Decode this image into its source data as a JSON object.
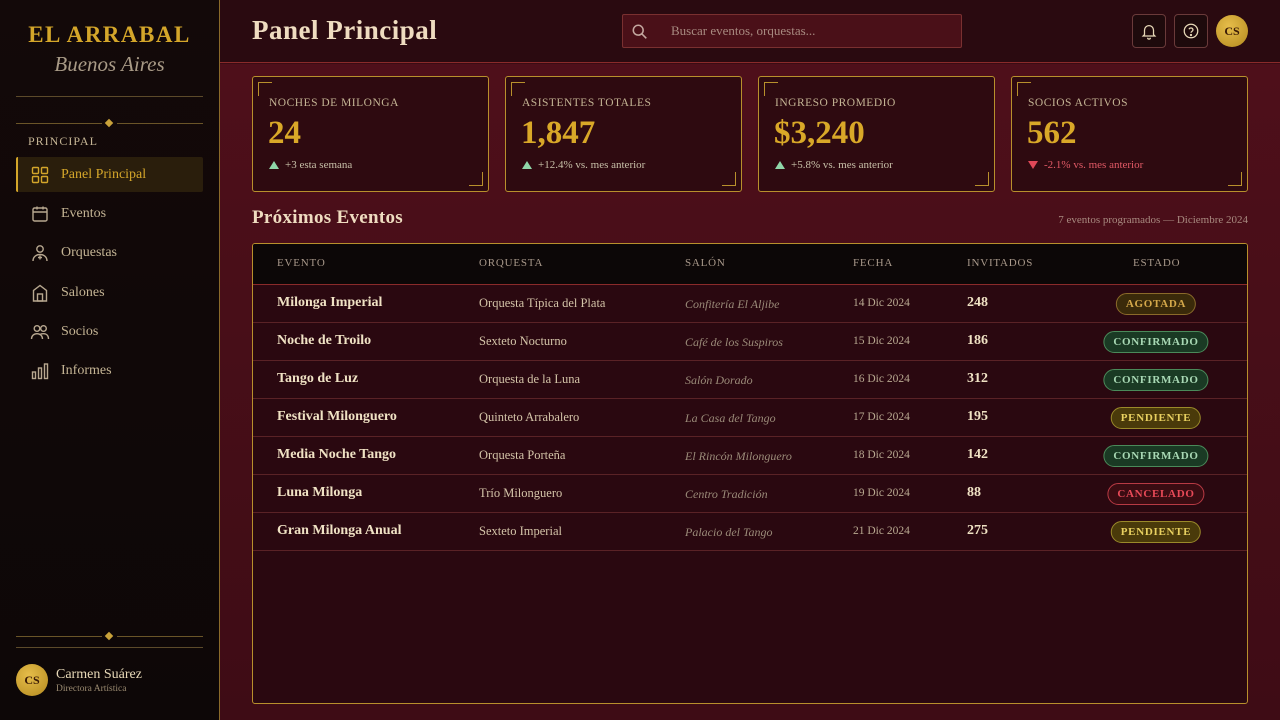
{
  "brand": {
    "title": "EL ARRABAL",
    "subtitle": "Buenos Aires"
  },
  "sidebar": {
    "section": "PRINCIPAL",
    "items": [
      {
        "label": "Panel Principal",
        "icon": "grid-icon",
        "active": true
      },
      {
        "label": "Eventos",
        "icon": "calendar-icon"
      },
      {
        "label": "Orquestas",
        "icon": "musician-icon"
      },
      {
        "label": "Salones",
        "icon": "building-icon"
      },
      {
        "label": "Socios",
        "icon": "people-icon"
      },
      {
        "label": "Informes",
        "icon": "bar-chart-icon"
      }
    ],
    "user": {
      "initials": "CS",
      "name": "Carmen Suárez",
      "role": "Directora Artística"
    }
  },
  "header": {
    "title": "Panel Principal",
    "search_placeholder": "Buscar eventos, orquestas...",
    "avatar_initials": "CS"
  },
  "stats": [
    {
      "label": "NOCHES DE MILONGA",
      "value": "24",
      "delta": "+3 esta semana",
      "trend": "up"
    },
    {
      "label": "ASISTENTES TOTALES",
      "value": "1,847",
      "delta": "+12.4% vs. mes anterior",
      "trend": "up"
    },
    {
      "label": "INGRESO PROMEDIO",
      "value": "$3,240",
      "delta": "+5.8% vs. mes anterior",
      "trend": "up"
    },
    {
      "label": "SOCIOS ACTIVOS",
      "value": "562",
      "delta": "-2.1% vs. mes anterior",
      "trend": "down"
    }
  ],
  "events": {
    "title": "Próximos Eventos",
    "meta": "7 eventos programados — Diciembre 2024",
    "columns": [
      "EVENTO",
      "ORQUESTA",
      "SALÓN",
      "FECHA",
      "INVITADOS",
      "ESTADO"
    ],
    "rows": [
      {
        "evento": "Milonga Imperial",
        "orquesta": "Orquesta Típica del Plata",
        "salon": "Confitería El Aljibe",
        "fecha": "14 Dic 2024",
        "invitados": "248",
        "estado": "AGOTADA",
        "status": "agotada"
      },
      {
        "evento": "Noche de Troilo",
        "orquesta": "Sexteto Nocturno",
        "salon": "Café de los Suspiros",
        "fecha": "15 Dic 2024",
        "invitados": "186",
        "estado": "CONFIRMADO",
        "status": "confirmado"
      },
      {
        "evento": "Tango de Luz",
        "orquesta": "Orquesta de la Luna",
        "salon": "Salón Dorado",
        "fecha": "16 Dic 2024",
        "invitados": "312",
        "estado": "CONFIRMADO",
        "status": "confirmado"
      },
      {
        "evento": "Festival Milonguero",
        "orquesta": "Quinteto Arrabalero",
        "salon": "La Casa del Tango",
        "fecha": "17 Dic 2024",
        "invitados": "195",
        "estado": "PENDIENTE",
        "status": "pendiente"
      },
      {
        "evento": "Media Noche Tango",
        "orquesta": "Orquesta Porteña",
        "salon": "El Rincón Milonguero",
        "fecha": "18 Dic 2024",
        "invitados": "142",
        "estado": "CONFIRMADO",
        "status": "confirmado"
      },
      {
        "evento": "Luna Milonga",
        "orquesta": "Trío Milonguero",
        "salon": "Centro Tradición",
        "fecha": "19 Dic 2024",
        "invitados": "88",
        "estado": "CANCELADO",
        "status": "cancelado"
      },
      {
        "evento": "Gran Milonga Anual",
        "orquesta": "Sexteto Imperial",
        "salon": "Palacio del Tango",
        "fecha": "21 Dic 2024",
        "invitados": "275",
        "estado": "PENDIENTE",
        "status": "pendiente"
      }
    ]
  },
  "colors": {
    "gold": "#d4a62a",
    "burgundy": "#3a0c14",
    "sidebar": "#0d0707"
  }
}
